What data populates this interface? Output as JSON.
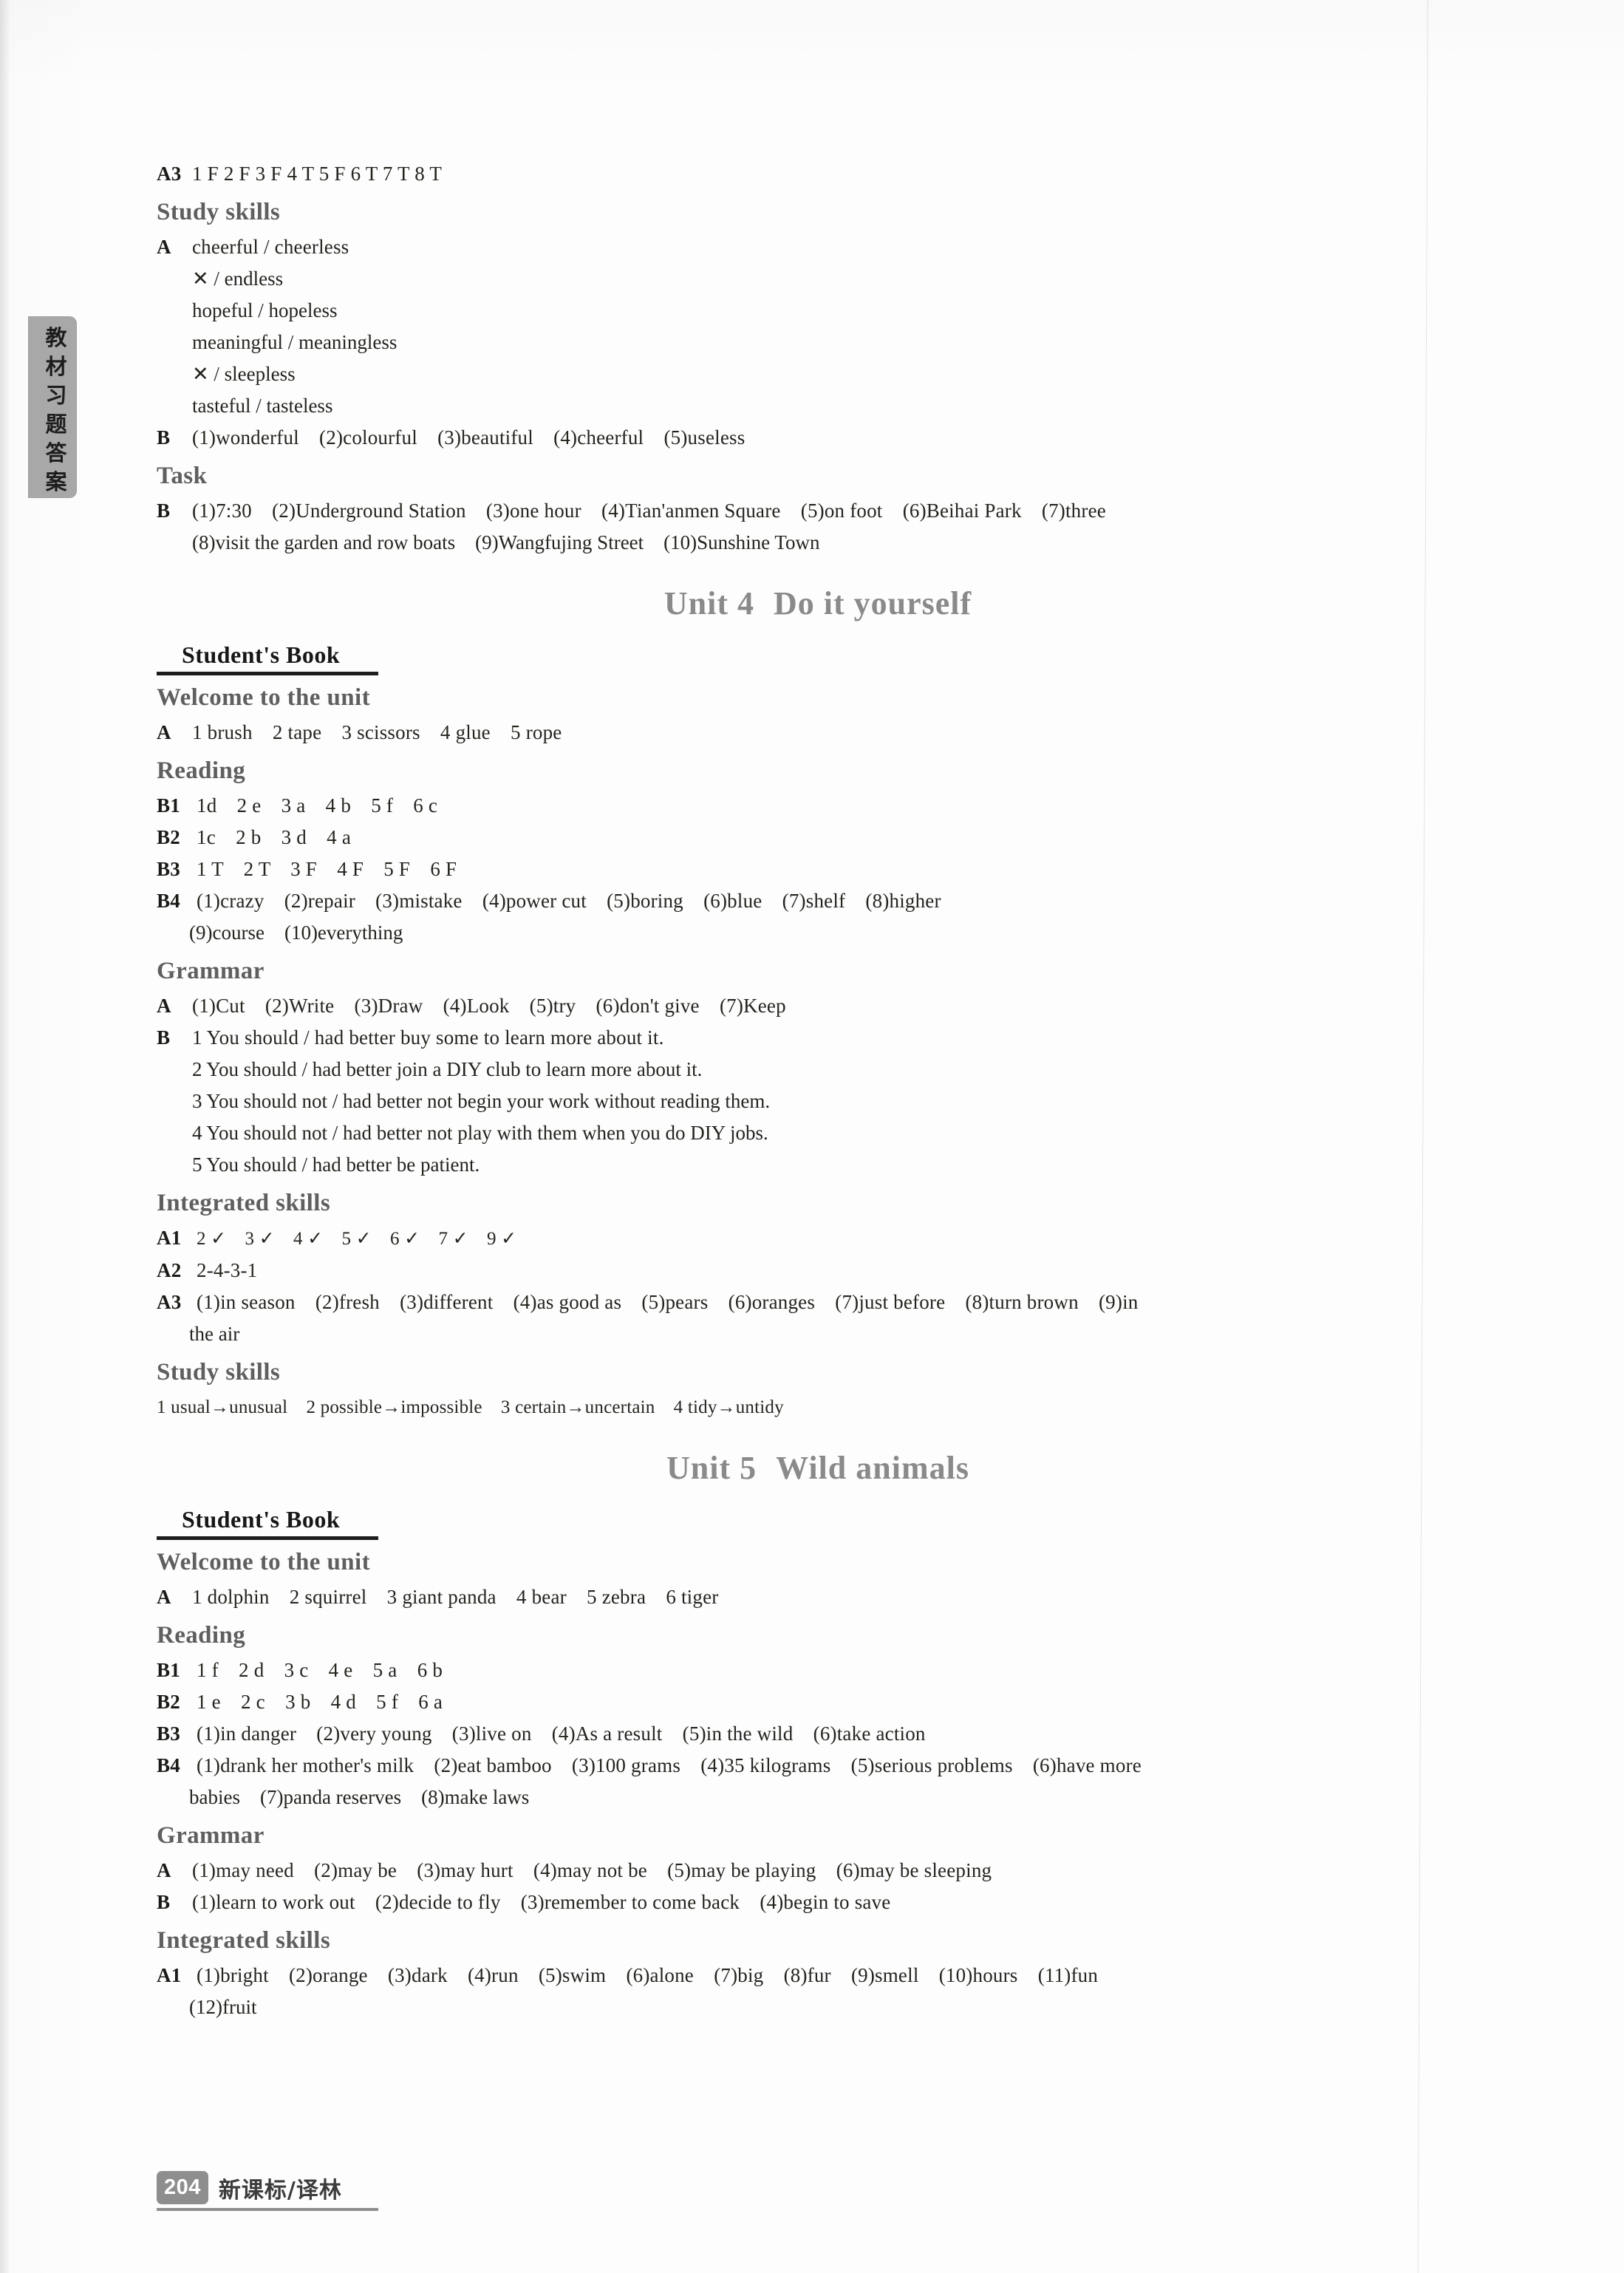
{
  "side_tab": {
    "label": "教材习题答案"
  },
  "footer": {
    "page_number": "204",
    "label": "新课标/译林"
  },
  "top_section": {
    "a3": {
      "label": "A3",
      "text": "1 F  2 F  3 F  4 T  5 F  6 T  7 T  8 T"
    },
    "study_skills_heading": "Study skills",
    "a": {
      "label": "A",
      "rows": [
        "cheerful / cheerless",
        "✕ / endless",
        "hopeful / hopeless",
        "meaningful / meaningless",
        "✕ / sleepless",
        "tasteful / tasteless"
      ]
    },
    "b": {
      "label": "B",
      "text": "(1)wonderful　(2)colourful　(3)beautiful　(4)cheerful　(5)useless"
    },
    "task_heading": "Task",
    "task_b": {
      "label": "B",
      "line1": "(1)7:30　(2)Underground Station　(3)one hour　(4)Tian'anmen Square　(5)on foot　(6)Beihai Park　(7)three",
      "line2": "(8)visit the garden and row boats　(9)Wangfujing Street　(10)Sunshine Town"
    }
  },
  "unit4": {
    "title_number": "Unit 4",
    "title_name": "Do it yourself",
    "book_heading": "Student's Book",
    "welcome_heading": "Welcome to the unit",
    "welcome_a": {
      "label": "A",
      "text": "1 brush　2 tape　3 scissors　4 glue　5 rope"
    },
    "reading_heading": "Reading",
    "b1": {
      "label": "B1",
      "text": "1d　2 e　3 a　4 b　5 f　6 c"
    },
    "b2": {
      "label": "B2",
      "text": "1c　2 b　3 d　4 a"
    },
    "b3": {
      "label": "B3",
      "text": "1 T　2 T　3 F　4 F　5 F　6 F"
    },
    "b4": {
      "label": "B4",
      "line1": "(1)crazy　(2)repair　(3)mistake　(4)power cut　(5)boring　(6)blue　(7)shelf　(8)higher",
      "line2": "(9)course　(10)everything"
    },
    "grammar_heading": "Grammar",
    "grammar_a": {
      "label": "A",
      "text": "(1)Cut　(2)Write　(3)Draw　(4)Look　(5)try　(6)don't give　(7)Keep"
    },
    "grammar_b": {
      "label": "B",
      "items": [
        "1 You should / had better buy some to learn more about it.",
        "2 You should / had better join a DIY club to learn more about it.",
        "3 You should not / had better not begin your work without reading them.",
        "4 You should not / had better not play with them when you do DIY jobs.",
        "5 You should / had better be patient."
      ]
    },
    "integrated_heading": "Integrated skills",
    "a1": {
      "label": "A1",
      "text": "2 ✓　3 ✓　4 ✓　5 ✓　6 ✓　7 ✓　9 ✓"
    },
    "a2": {
      "label": "A2",
      "text": "2-4-3-1"
    },
    "a3": {
      "label": "A3",
      "line1": "(1)in season　(2)fresh　(3)different　(4)as good as　(5)pears　(6)oranges　(7)just before　(8)turn brown　(9)in",
      "line2": "the air"
    },
    "study_skills_heading": "Study skills",
    "study_skills_line": "1 usual→unusual　2 possible→impossible　3 certain→uncertain　4 tidy→untidy"
  },
  "unit5": {
    "title_number": "Unit 5",
    "title_name": "Wild animals",
    "book_heading": "Student's Book",
    "welcome_heading": "Welcome to the unit",
    "welcome_a": {
      "label": "A",
      "text": "1 dolphin　2 squirrel　3 giant panda　4 bear　5 zebra　6 tiger"
    },
    "reading_heading": "Reading",
    "b1": {
      "label": "B1",
      "text": "1 f　2 d　3 c　4 e　5 a　6 b"
    },
    "b2": {
      "label": "B2",
      "text": "1 e　2 c　3 b　4 d　5 f　6 a"
    },
    "b3": {
      "label": "B3",
      "text": "(1)in danger　(2)very young　(3)live on　(4)As a result　(5)in the wild　(6)take action"
    },
    "b4": {
      "label": "B4",
      "line1": "(1)drank her mother's milk　(2)eat bamboo　(3)100 grams　(4)35 kilograms　(5)serious problems　(6)have more",
      "line2": "babies　(7)panda reserves　(8)make laws"
    },
    "grammar_heading": "Grammar",
    "grammar_a": {
      "label": "A",
      "text": "(1)may need　(2)may be　(3)may hurt　(4)may not be　(5)may be playing　(6)may be sleeping"
    },
    "grammar_b": {
      "label": "B",
      "text": "(1)learn to work out　(2)decide to fly　(3)remember to come back　(4)begin to save"
    },
    "integrated_heading": "Integrated skills",
    "a1": {
      "label": "A1",
      "line1": "(1)bright　(2)orange　(3)dark　(4)run　(5)swim　(6)alone　(7)big　(8)fur　(9)smell　(10)hours　(11)fun",
      "line2": "(12)fruit"
    }
  }
}
